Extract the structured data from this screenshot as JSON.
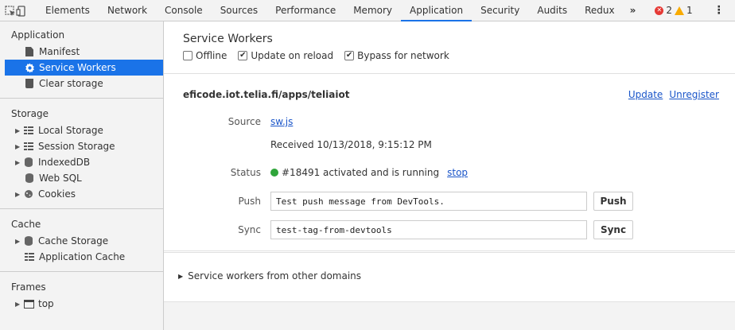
{
  "toolbar": {
    "tabs": [
      "Elements",
      "Network",
      "Console",
      "Sources",
      "Performance",
      "Memory",
      "Application",
      "Security",
      "Audits",
      "Redux"
    ],
    "active_tab": "Application",
    "more": "»",
    "error_count": "2",
    "warning_count": "1",
    "menu": "⋮",
    "close": "✕"
  },
  "sidebar": {
    "application": {
      "heading": "Application",
      "items": [
        "Manifest",
        "Service Workers",
        "Clear storage"
      ]
    },
    "storage": {
      "heading": "Storage",
      "items": [
        "Local Storage",
        "Session Storage",
        "IndexedDB",
        "Web SQL",
        "Cookies"
      ]
    },
    "cache": {
      "heading": "Cache",
      "items": [
        "Cache Storage",
        "Application Cache"
      ]
    },
    "frames": {
      "heading": "Frames",
      "items": [
        "top"
      ]
    }
  },
  "main": {
    "title": "Service Workers",
    "options": {
      "offline": {
        "label": "Offline",
        "checked": false
      },
      "update_on_reload": {
        "label": "Update on reload",
        "checked": true
      },
      "bypass": {
        "label": "Bypass for network",
        "checked": true
      }
    },
    "worker": {
      "origin": "eficode.iot.telia.fi/apps/teliaiot",
      "update_link": "Update",
      "unregister_link": "Unregister",
      "source_label": "Source",
      "source_link": "sw.js",
      "received": "Received 10/13/2018, 9:15:12 PM",
      "status_label": "Status",
      "status_text": "#18491 activated and is running",
      "stop_link": "stop",
      "push_label": "Push",
      "push_value": "Test push message from DevTools.",
      "push_button": "Push",
      "sync_label": "Sync",
      "sync_value": "test-tag-from-devtools",
      "sync_button": "Sync"
    },
    "other_domains": "Service workers from other domains"
  },
  "colors": {
    "accent": "#1a73e8",
    "status_green": "#2fa53a",
    "error_red": "#e53935",
    "warning_yellow": "#f9ab00",
    "link_blue": "#1a55c9"
  }
}
